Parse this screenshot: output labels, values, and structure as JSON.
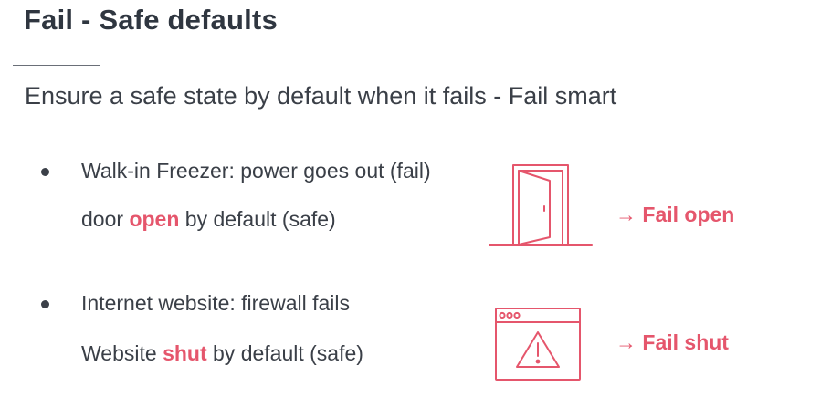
{
  "slide": {
    "title": "Fail - Safe defaults",
    "subtitle": "Ensure a safe state by default when it fails - Fail smart",
    "accent_color": "#e5566c",
    "items": [
      {
        "line1": "Walk-in Freezer: power goes out (fail)",
        "line2_prefix": "door ",
        "line2_highlight": "open",
        "line2_suffix": " by default (safe)",
        "icon": "door-open-icon",
        "result": "→ Fail open"
      },
      {
        "line1": "Internet website: firewall fails",
        "line2_prefix": "Website ",
        "line2_highlight": "shut",
        "line2_suffix": " by default (safe)",
        "icon": "browser-warning-icon",
        "result": "→ Fail shut"
      }
    ]
  }
}
